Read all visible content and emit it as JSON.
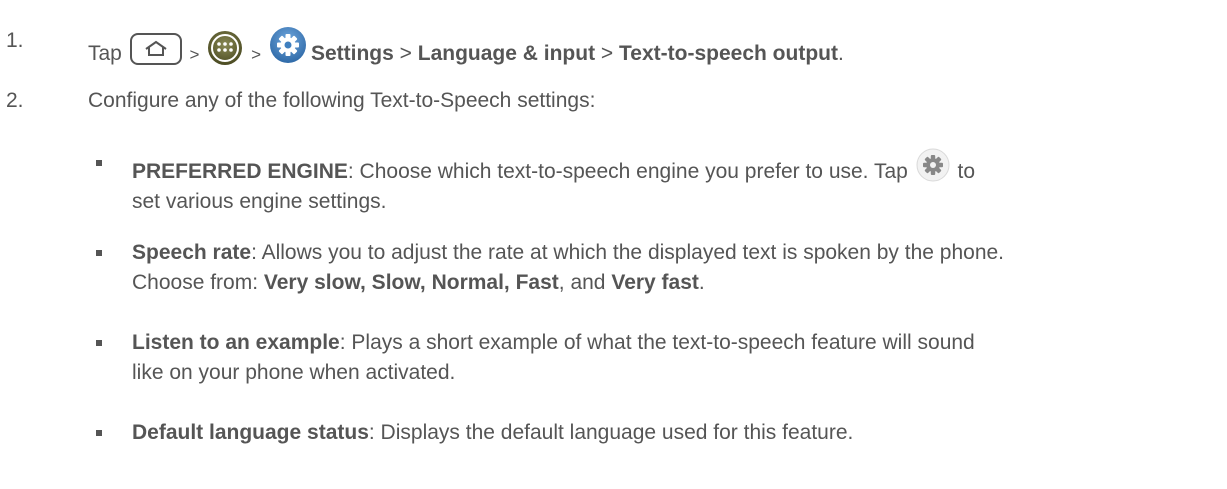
{
  "steps": [
    {
      "number": "1.",
      "tap": "Tap",
      "sep1": ">",
      "sep2": ">",
      "settings": "Settings",
      "sep3": ">",
      "language": "Language & input",
      "sep4": ">",
      "tts_output": "Text-to-speech output",
      "end": "."
    },
    {
      "number": "2.",
      "text": "Configure any of the following Text-to-Speech settings:"
    }
  ],
  "bullets": [
    {
      "term": "PREFERRED ENGINE",
      "line1": ": Choose which text-to-speech engine you prefer to use. Tap",
      "line1_after_icon": "to",
      "line2": "set various engine settings."
    },
    {
      "term": "Speech rate",
      "line1": ": Allows you to adjust the rate at which the displayed text is spoken by the phone.",
      "line2_prefix": "Choose from:",
      "options": "Very slow, Slow, Normal, Fast",
      "line2_and": ", and",
      "last_option": "Very fast",
      "line2_end": "."
    },
    {
      "term": "Listen to an example",
      "line1": ": Plays a short example of what the text-to-speech feature will sound",
      "line2": "like on your phone when activated."
    },
    {
      "term": "Default language status",
      "line1": ": Displays the default language used for this feature."
    }
  ],
  "icons": {
    "home": "home-key-icon",
    "apps": "apps-icon",
    "settings": "settings-gear-icon"
  },
  "colors": {
    "text": "#555555",
    "gear_blue": "#3f7fbf",
    "apps_olive": "#6b6b3a"
  }
}
